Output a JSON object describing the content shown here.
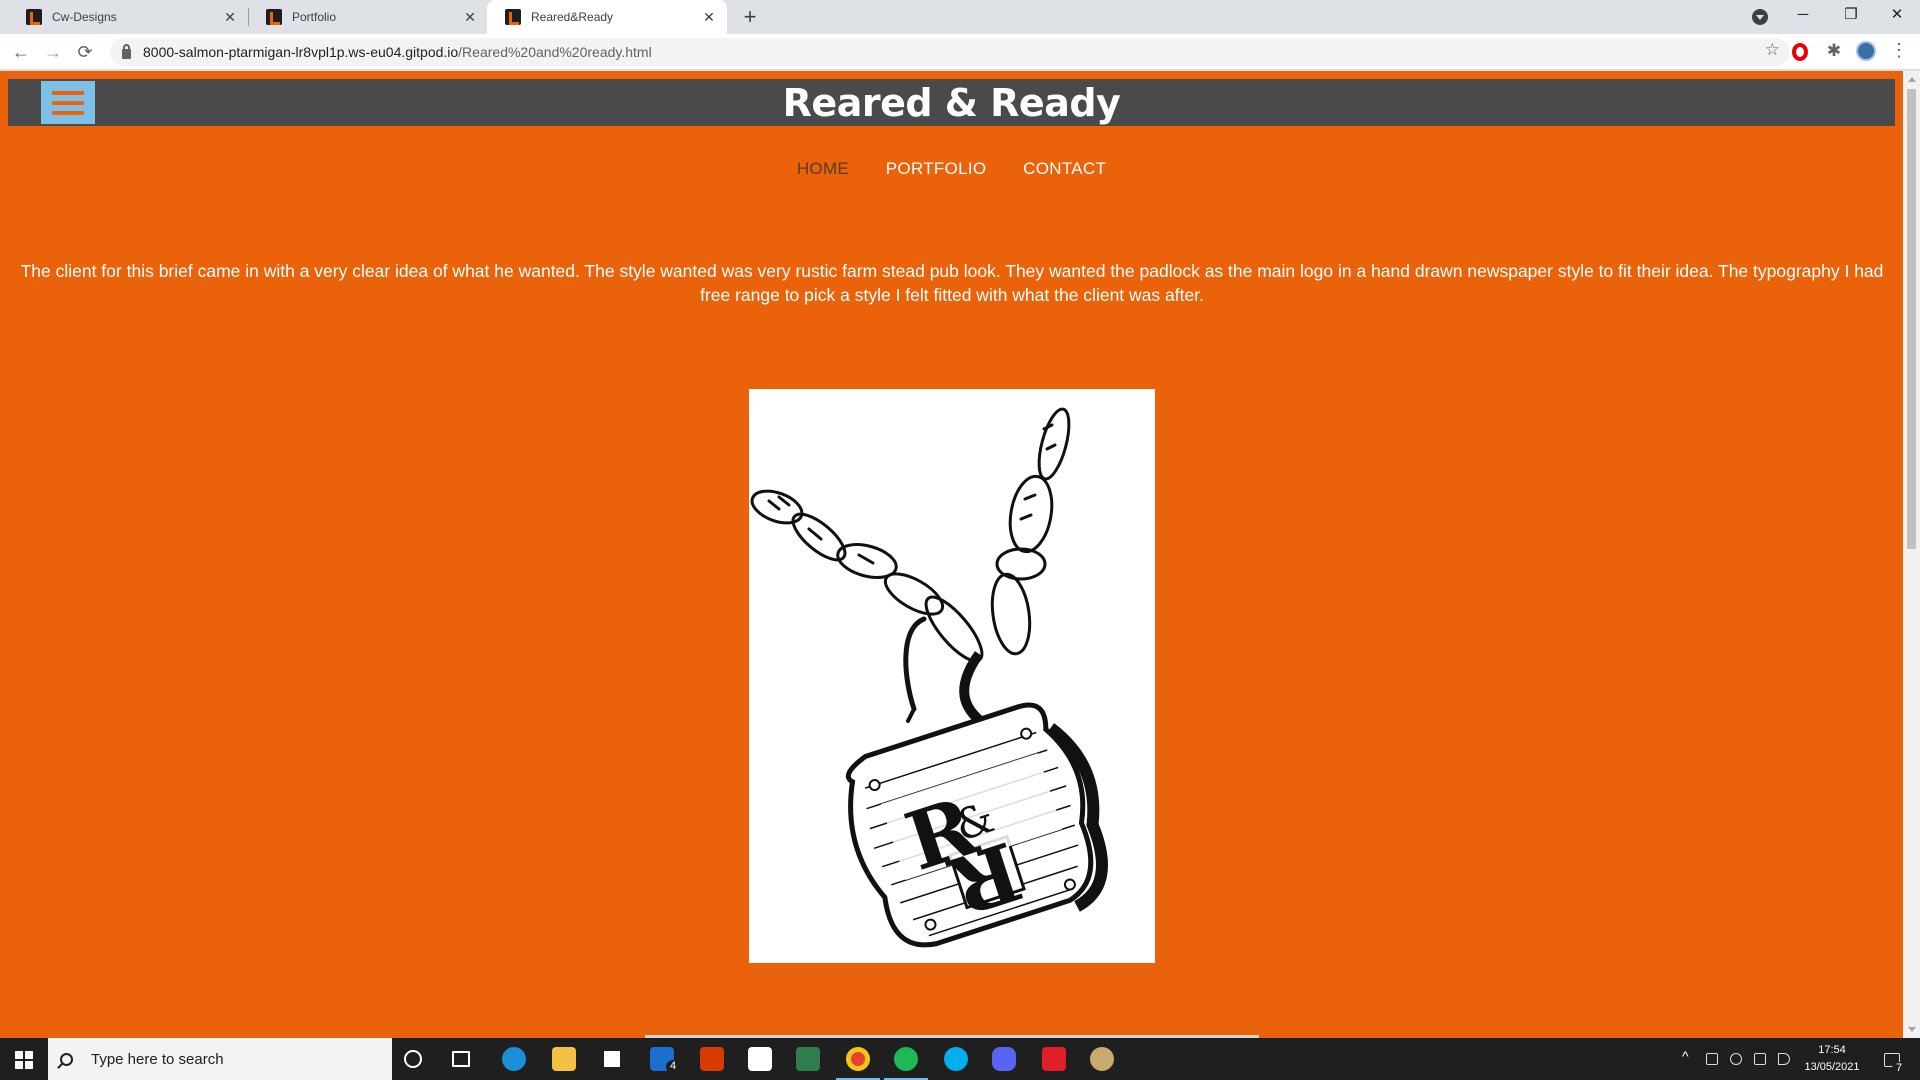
{
  "browser": {
    "tabs": [
      {
        "title": "Cw-Designs",
        "active": false
      },
      {
        "title": "Portfolio",
        "active": false
      },
      {
        "title": "Reared&Ready",
        "active": true
      }
    ],
    "url_host": "8000-salmon-ptarmigan-lr8vpl1p.ws-eu04.gitpod.io",
    "url_path": "/Reared%20and%20ready.html",
    "controls": {
      "back": "←",
      "forward": "→",
      "reload": "⟳",
      "new_tab": "+",
      "minimize": "─",
      "restore": "❐",
      "close": "✕",
      "tab_close": "✕",
      "bookmark": "☆",
      "extensions": "✱",
      "menu": "⋮"
    }
  },
  "site": {
    "title": "Reared & Ready",
    "nav": [
      {
        "label": "HOME",
        "current": true
      },
      {
        "label": "PORTFOLIO",
        "current": false
      },
      {
        "label": "CONTACT",
        "current": false
      }
    ],
    "brief": "The client for this brief came in with a very clear idea of what he wanted. The style wanted was very rustic farm stead pub look. They wanted the padlock as the main logo in a hand drawn newspaper style to fit their idea. The typography I had free range to pick a style I felt fitted with what the client was after.",
    "logo": {
      "letter_left": "R",
      "ampersand": "&",
      "letter_right": "R"
    }
  },
  "taskbar": {
    "search_placeholder": "Type here to search",
    "time": "17:54",
    "date": "13/05/2021",
    "mail_badge": "4",
    "notification_badge": "7"
  },
  "colors": {
    "page_background": "#ea6209",
    "header_background": "#4a4a4a",
    "menu_button": "#7cc0e8",
    "nav_current": "#5a3a28"
  }
}
